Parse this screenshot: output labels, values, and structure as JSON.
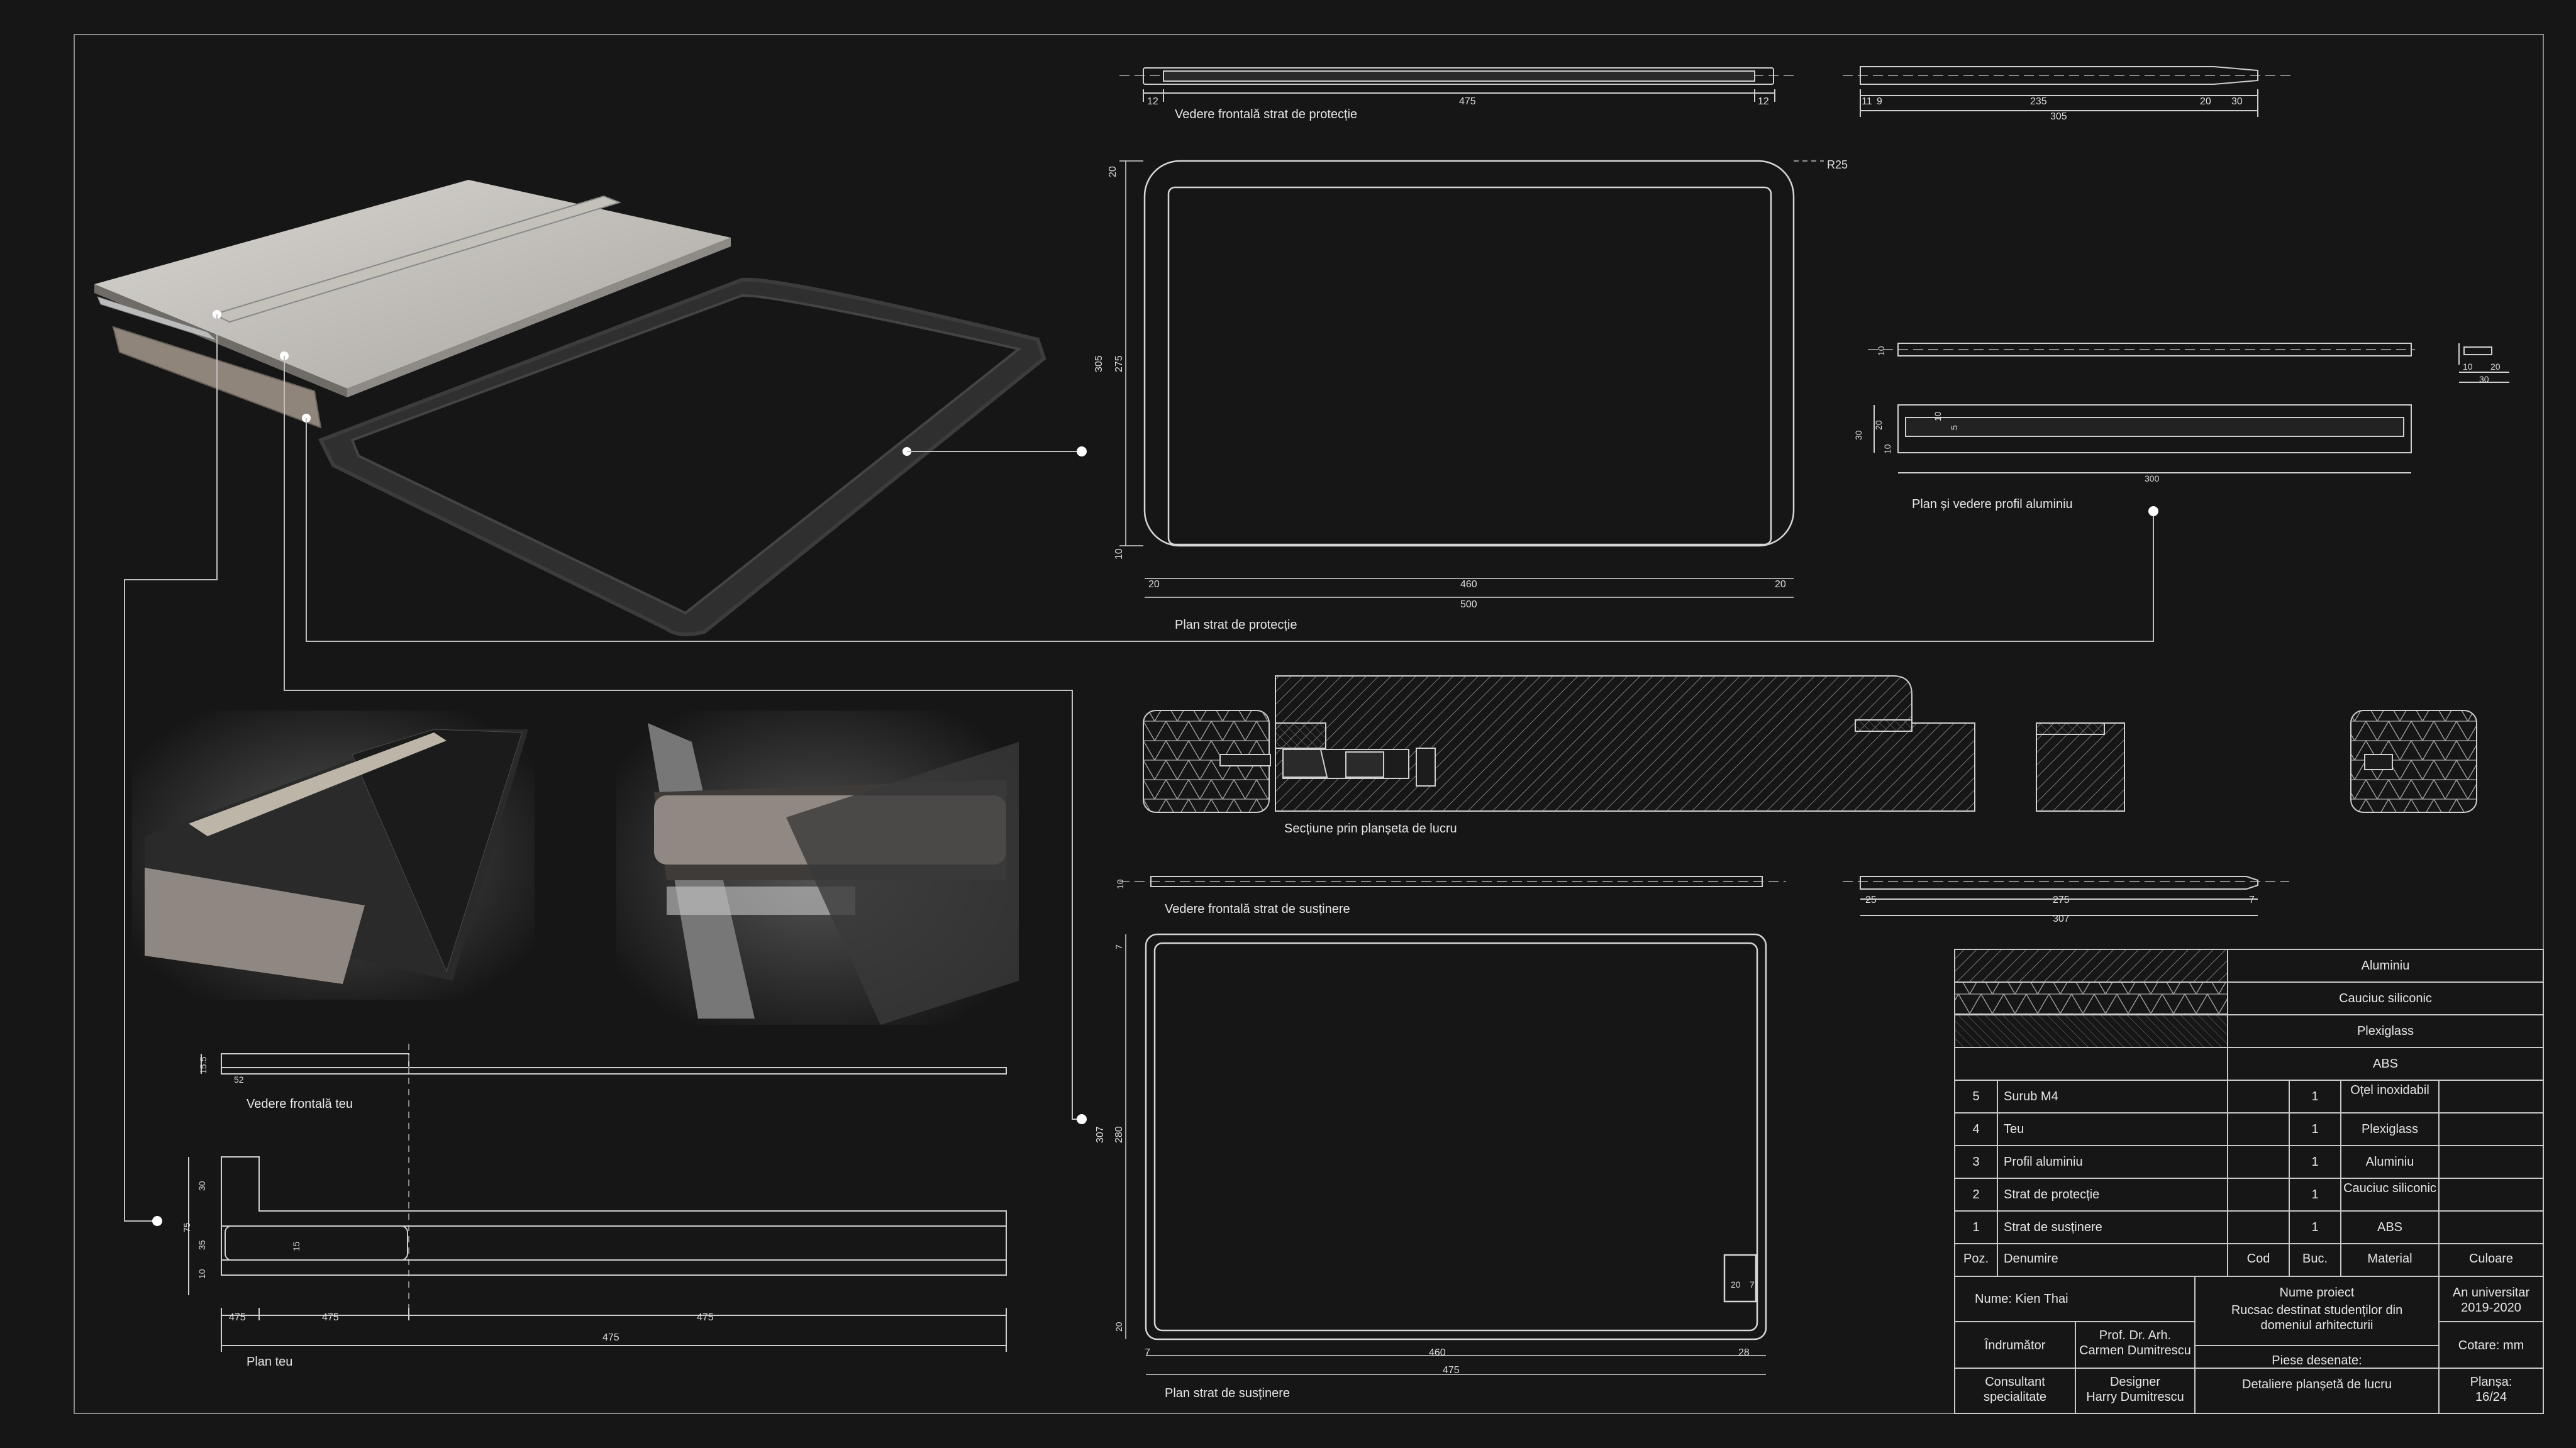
{
  "captions": {
    "front_protection": "Vedere frontală strat de protecție",
    "plan_protection": "Plan strat de protecție",
    "profile": "Plan și vedere profil aluminiu",
    "section": "Secțiune prin planșeta de lucru",
    "front_support": "Vedere frontală strat de susținere",
    "plan_support": "Plan strat de susținere",
    "front_tee": "Vedere frontală teu",
    "plan_tee": "Plan teu"
  },
  "dims": {
    "fp_a": "12",
    "fp_b": "475",
    "fp_c": "12",
    "fs_a": "11",
    "fs_b": "9",
    "fs_c": "235",
    "fs_d": "20",
    "fs_e": "30",
    "fs_f": "305",
    "pp_r": "R25",
    "pp_h1": "20",
    "pp_h2": "275",
    "pp_h3": "305",
    "pp_h4": "10",
    "pp_w1": "20",
    "pp_w2": "460",
    "pp_w3": "20",
    "pp_w4": "500",
    "pr_t": "10",
    "pr_s1": "10",
    "pr_s2": "20",
    "pr_s3": "30",
    "pr_h1": "30",
    "pr_h2": "20",
    "pr_h3": "10",
    "pr_h4": "10",
    "pr_h5": "5",
    "pr_l": "300",
    "su_t": "10",
    "su_a": "25",
    "su_b": "275",
    "su_c": "7",
    "su_d": "307",
    "ps_h1": "7",
    "ps_h2": "280",
    "ps_h3": "307",
    "ps_h4": "20",
    "ps_w1": "7",
    "ps_w2": "460",
    "ps_w3": "28",
    "ps_w4": "475",
    "ps_x1": "20",
    "ps_x2": "7",
    "te_a": "15.5",
    "te_b": "52",
    "pt_a": "30",
    "pt_b": "75",
    "pt_c": "35",
    "pt_d": "10",
    "pt_e": "15",
    "pt_w1": "475",
    "pt_w2": "475",
    "pt_w3": "475",
    "pt_w4": "475"
  },
  "legend": {
    "materials": [
      "Aluminiu",
      "Cauciuc siliconic",
      "Plexiglass",
      "ABS"
    ],
    "rows": [
      {
        "poz": "5",
        "den": "Surub M4",
        "cod": "",
        "buc": "1",
        "mat": "Oțel inoxidabil",
        "cul": ""
      },
      {
        "poz": "4",
        "den": "Teu",
        "cod": "",
        "buc": "1",
        "mat": "Plexiglass",
        "cul": ""
      },
      {
        "poz": "3",
        "den": "Profil aluminiu",
        "cod": "",
        "buc": "1",
        "mat": "Aluminiu",
        "cul": ""
      },
      {
        "poz": "2",
        "den": "Strat de protecție",
        "cod": "",
        "buc": "1",
        "mat": "Cauciuc siliconic",
        "cul": ""
      },
      {
        "poz": "1",
        "den": "Strat de susținere",
        "cod": "",
        "buc": "1",
        "mat": "ABS",
        "cul": ""
      }
    ],
    "header": {
      "poz": "Poz.",
      "den": "Denumire",
      "cod": "Cod",
      "buc": "Buc.",
      "mat": "Material",
      "cul": "Culoare"
    }
  },
  "titleblock": {
    "name": "Nume: Kien Thai",
    "project_label": "Nume proiect",
    "project": "Rucsac destinat studenților din domeniul arhitecturii",
    "year_label": "An universitar",
    "year": "2019-2020",
    "advisor_label": "Îndrumător",
    "advisor": "Prof. Dr. Arh. Carmen Dumitrescu",
    "units": "Cotare: mm",
    "consultant_label": "Consultant specialitate",
    "designer_label": "Designer",
    "designer": "Harry Dumitrescu",
    "pieces_label": "Piese desenate:",
    "pieces": "Detaliere planșetă de lucru",
    "sheet_label": "Planșa:",
    "sheet": "16/24"
  }
}
